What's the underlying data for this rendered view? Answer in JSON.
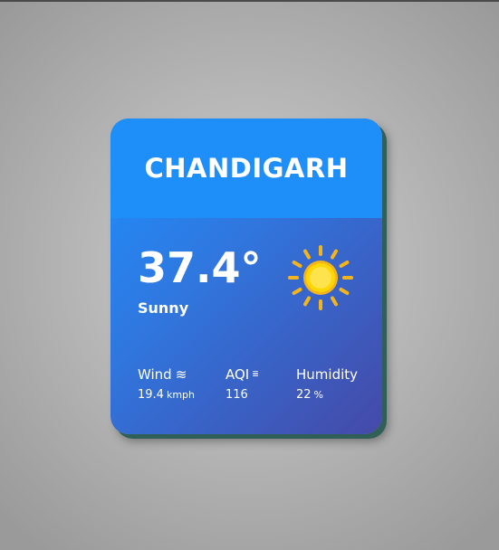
{
  "city": "CHANDIGARH",
  "temperature": "37.4°",
  "condition": "Sunny",
  "weather_icon": "sun-icon",
  "stats": {
    "wind": {
      "label": "Wind",
      "icon": "wind-icon",
      "value": "19.4",
      "unit": "kmph"
    },
    "aqi": {
      "label": "AQI",
      "icon": "aqi-icon",
      "value": "116"
    },
    "humidity": {
      "label": "Humidity",
      "value": "22",
      "unit": "%"
    }
  },
  "colors": {
    "header": "#1e8ff9",
    "gradient_start": "#1e90ff",
    "gradient_end": "#4549a8",
    "sun_core": "#ffd700",
    "sun_rays": "#f6b41b"
  }
}
